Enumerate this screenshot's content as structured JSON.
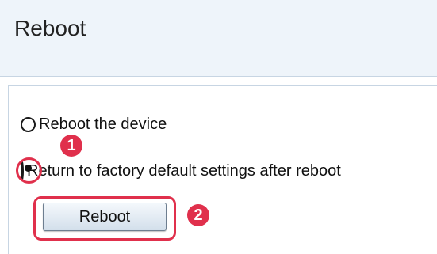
{
  "page": {
    "title": "Reboot"
  },
  "options": [
    {
      "label": "Reboot the device",
      "checked": false
    },
    {
      "label": "Return to factory default settings after reboot",
      "checked": true
    }
  ],
  "button": {
    "label": "Reboot"
  },
  "annotations": {
    "step1": "1",
    "step2": "2",
    "highlight_color": "#e0304c"
  }
}
